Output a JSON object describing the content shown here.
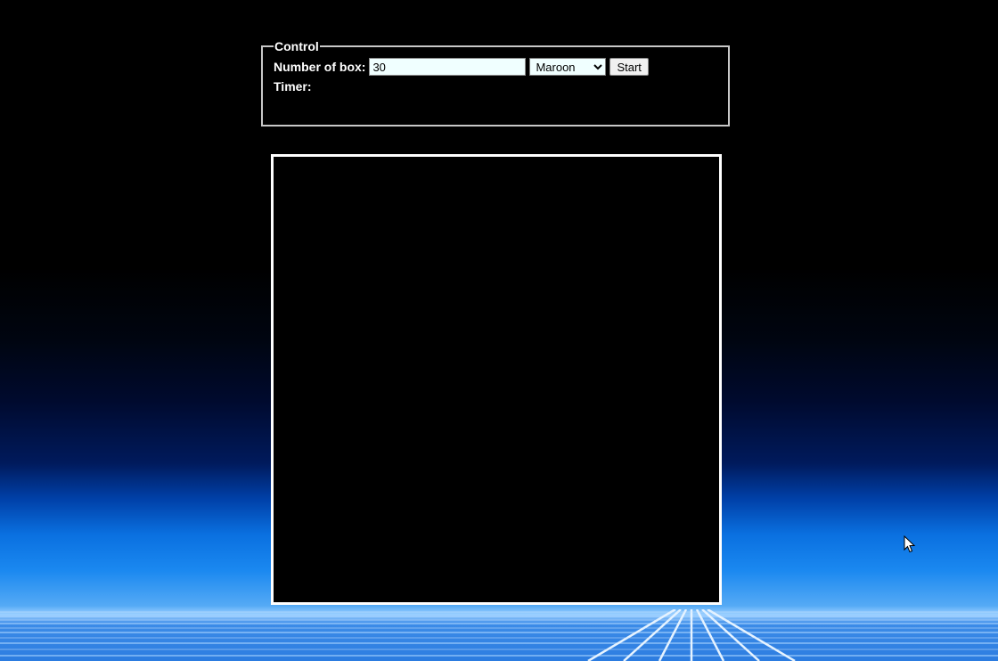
{
  "control": {
    "legend": "Control",
    "box_count_label": "Number of box:",
    "box_count_value": "30",
    "color_select_value": "Maroon",
    "color_options": [
      "Maroon"
    ],
    "start_label": "Start",
    "timer_label": "Timer:",
    "timer_value": ""
  },
  "colors": {
    "page_top": "#000000",
    "horizon": "#1a88f0",
    "board_background": "#000000",
    "board_border": "#ffffff"
  }
}
